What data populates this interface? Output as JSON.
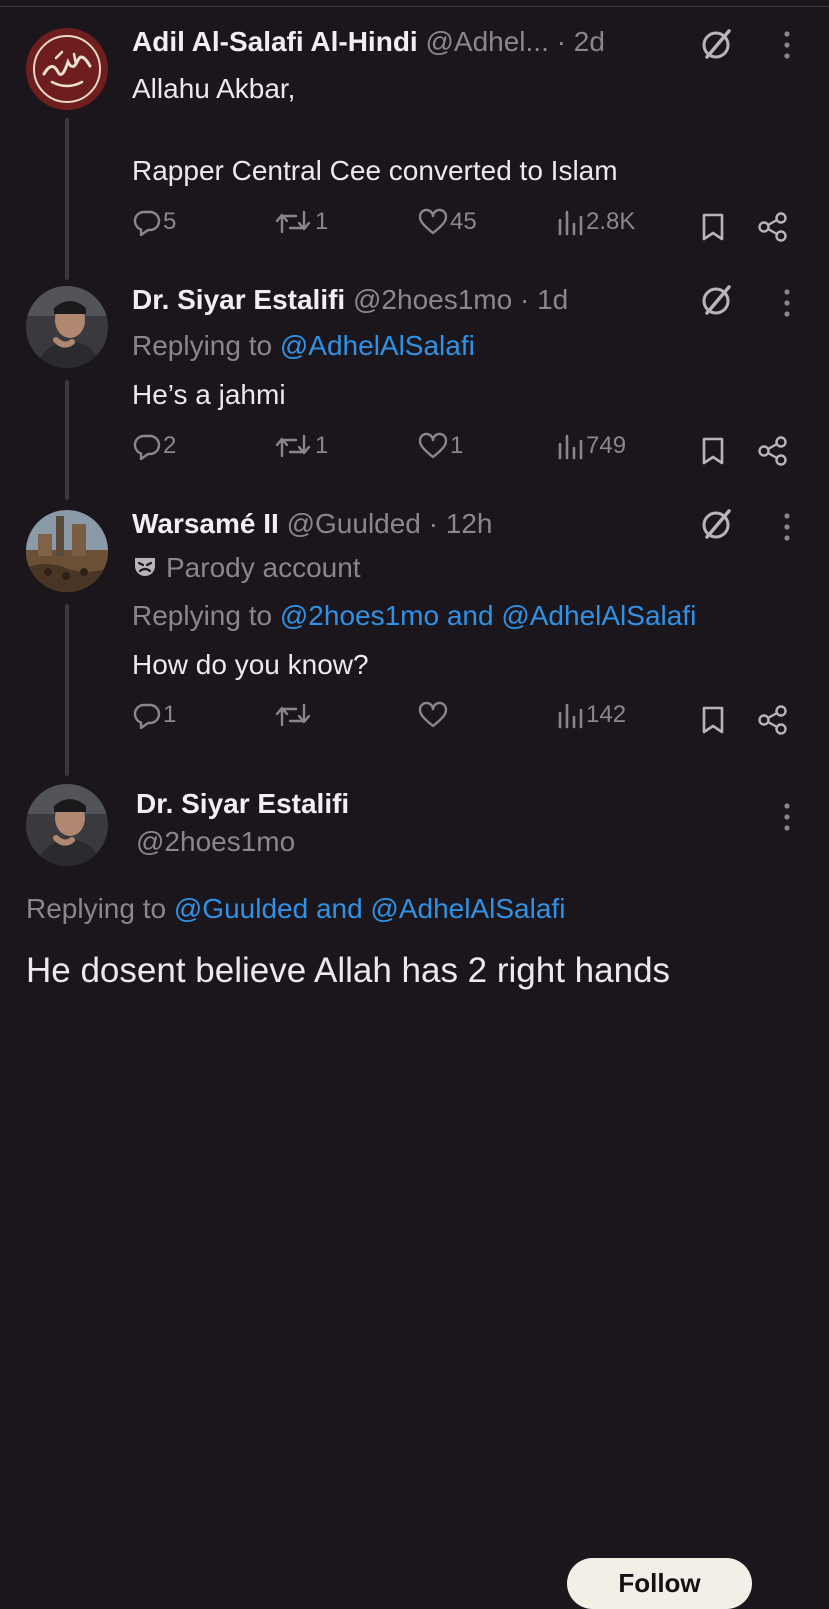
{
  "tweets": [
    {
      "name": "Adil Al-Salafi Al-Hindi",
      "handle": "@Adhel...",
      "time": "· 2d",
      "text": "Allahu Akbar,\n\nRapper Central Cee converted to Islam",
      "stats": {
        "replies": "5",
        "reposts": "1",
        "likes": "45",
        "views": "2.8K"
      }
    },
    {
      "name": "Dr. Siyar Estalifi",
      "handle": "@2hoes1mo",
      "time": "· 1d",
      "replying_label": "Replying to",
      "replying_to": "@AdhelAlSalafi",
      "text": "He’s a jahmi",
      "stats": {
        "replies": "2",
        "reposts": "1",
        "likes": "1",
        "views": "749"
      }
    },
    {
      "name": "Warsamé II",
      "handle": "@Guulded",
      "time": "· 12h",
      "parody_label": "Parody account",
      "replying_label": "Replying to",
      "replying_to": "@2hoes1mo and @AdhelAlSalafi",
      "text": "How do you know?",
      "stats": {
        "replies": "1",
        "reposts": "",
        "likes": "",
        "views": "142"
      }
    }
  ],
  "main": {
    "name": "Dr. Siyar Estalifi",
    "handle": "@2hoes1mo",
    "follow_label": "Follow",
    "replying_label": "Replying to",
    "replying_to": "@Guulded and @AdhelAlSalafi",
    "text": "He dosent believe Allah has 2 right hands"
  },
  "icons": {
    "reply": "reply-icon",
    "repost": "repost-icon",
    "like": "heart-icon",
    "views": "views-icon",
    "bookmark": "bookmark-icon",
    "share": "share-icon",
    "grok": "grok-icon",
    "more": "more-vertical-icon",
    "parody": "parody-mask-icon"
  },
  "colors": {
    "background": "#1b161b",
    "link": "#2f92e6",
    "muted": "#8c868c",
    "follow_bg": "#f3efe7"
  }
}
